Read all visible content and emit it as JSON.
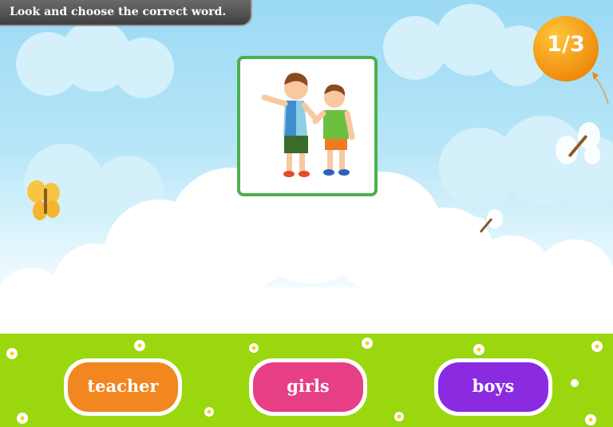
{
  "instruction": "Look and choose the correct word.",
  "progress": {
    "label": "1/3",
    "current": 1,
    "total": 3
  },
  "picture": {
    "icon": "two-boys-illustration"
  },
  "choices": [
    {
      "label": "teacher",
      "color": "#f2861f"
    },
    {
      "label": "girls",
      "color": "#e63f86"
    },
    {
      "label": "boys",
      "color": "#8a2be2"
    }
  ],
  "colors": {
    "card_border": "#4cb04c",
    "ground": "#9ad70e",
    "balloon": "#f39a12"
  }
}
